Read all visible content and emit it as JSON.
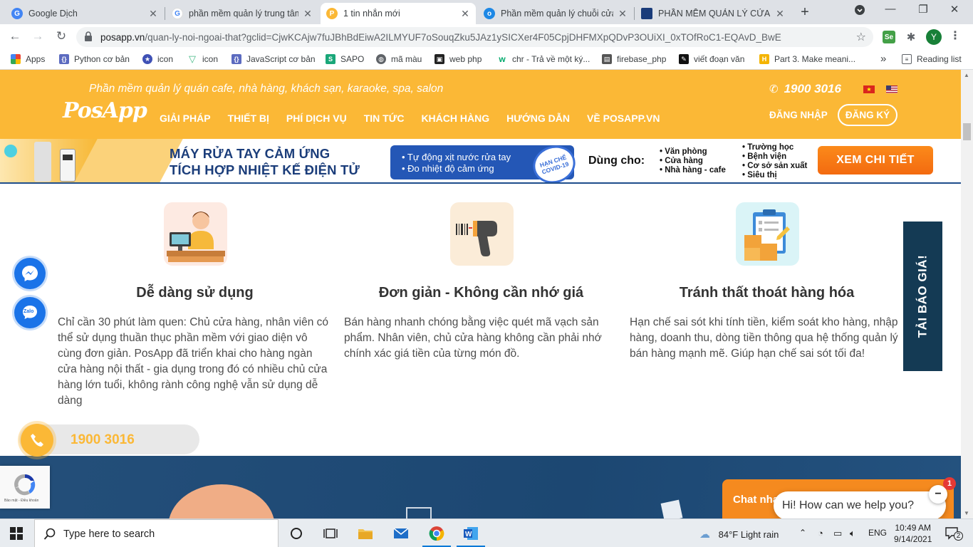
{
  "browser": {
    "tabs": [
      {
        "title": "Google Dịch",
        "favicon_color": "#4285f4",
        "favicon_glyph": "G",
        "active": false
      },
      {
        "title": "phần mềm quản lý trung tâm",
        "favicon_color": "#ffffff",
        "favicon_glyph": "G",
        "active": false
      },
      {
        "title": "1 tin nhắn mới",
        "favicon_color": "#fbb836",
        "favicon_glyph": "P",
        "active": true
      },
      {
        "title": "Phần mềm quản lý chuỗi cửa",
        "favicon_color": "#1e88e5",
        "favicon_glyph": "o",
        "active": false
      },
      {
        "title": "PHẦN MỀM QUẢN LÝ CỬA HÀ",
        "favicon_color": "#1a3c7a",
        "favicon_glyph": "",
        "active": false
      }
    ],
    "new_tab": "+",
    "url_host": "posapp.vn",
    "url_path": "/quan-ly-noi-ngoai-that?gclid=CjwKCAjw7fuJBhBdEiwA2ILMYUF7oSouqZku5JAz1ySICXer4F05CpjDHFMXpQDvP3OUiXI_0xTOfRoC1-EQAvD_BwE",
    "profile_initial": "Y",
    "bookmarks": [
      {
        "label": "Apps",
        "icon": "apps-grid-icon",
        "color": "#e94235"
      },
      {
        "label": "Python cơ bản",
        "icon": "bracket-icon",
        "color": "#5c6bc0"
      },
      {
        "label": "icon",
        "icon": "star-badge-icon",
        "color": "#3f51b5"
      },
      {
        "label": "icon",
        "icon": "vue-icon",
        "color": "#41b883"
      },
      {
        "label": "JavaScript cơ bản",
        "icon": "bracket-icon",
        "color": "#5c6bc0"
      },
      {
        "label": "SAPO",
        "icon": "sapo-icon",
        "color": "#1aa779"
      },
      {
        "label": "mã màu",
        "icon": "globe-icon",
        "color": "#5f6368"
      },
      {
        "label": "web php",
        "icon": "php-icon",
        "color": "#222222"
      },
      {
        "label": "chr - Trả về một ký...",
        "icon": "w3-icon",
        "color": "#04aa6d"
      },
      {
        "label": "firebase_php",
        "icon": "page-icon",
        "color": "#555555"
      },
      {
        "label": "viết đoạn văn",
        "icon": "pen-icon",
        "color": "#111111"
      },
      {
        "label": "Part 3. Make meani...",
        "icon": "h-icon",
        "color": "#f4b400"
      }
    ],
    "reading_list": "Reading list",
    "more_bookmarks": "»"
  },
  "site": {
    "tagline": "Phần mềm quản lý quán cafe, nhà hàng, khách sạn, karaoke, spa, salon",
    "logo": "PosApp",
    "nav": [
      "GIẢI PHÁP",
      "THIẾT BỊ",
      "PHÍ DỊCH VỤ",
      "TIN TỨC",
      "KHÁCH HÀNG",
      "HƯỚNG DẪN",
      "VỀ POSAPP.VN"
    ],
    "hotline": "1900 3016",
    "login": "ĐĂNG NHẬP",
    "register": "ĐĂNG KÝ",
    "accent": "#fbb836"
  },
  "banner": {
    "title_line1": "MÁY RỬA TAY CẢM ỨNG",
    "title_line2": "TÍCH HỢP NHIỆT KẾ ĐIỆN TỬ",
    "feature1": "• Tự động xịt nước rửa tay",
    "feature2": "• Đo nhiệt độ cảm ứng",
    "badge_line1": "HẠN CHẾ",
    "badge_line2": "COVID-19",
    "use_for": "Dùng cho:",
    "use_col1": [
      "• Văn phòng",
      "• Cửa hàng",
      "• Nhà hàng - cafe"
    ],
    "use_col2": [
      "• Trường học",
      "• Bệnh viện",
      "• Cơ sở sản xuất",
      "• Siêu thị"
    ],
    "cta": "XEM CHI TIẾT"
  },
  "features": [
    {
      "icon": "cashier-person-icon",
      "title": "Dễ dàng sử dụng",
      "desc": "Chỉ cần 30 phút làm quen: Chủ cửa hàng, nhân viên có thể sử dụng thuần thục phần mềm với giao diện vô cùng đơn giản. PosApp đã triển khai cho hàng ngàn cửa hàng nội thất - gia dụng trong đó có nhiều chủ cửa hàng lớn tuổi, không rành công nghệ vẫn sử dụng dễ dàng"
    },
    {
      "icon": "barcode-scanner-icon",
      "title": "Đơn giản - Không cần nhớ giá",
      "desc": "Bán hàng nhanh chóng bằng việc quét mã vạch sản phẩm. Nhân viên, chủ cửa hàng không cần phải nhớ chính xác giá tiền của từng món đồ."
    },
    {
      "icon": "inventory-clipboard-icon",
      "title": "Tránh thất thoát hàng hóa",
      "desc": "Hạn chế sai sót khi tính tiền, kiểm soát kho hàng, nhập hàng, doanh thu, dòng tiền thông qua hệ thống quản lý bán hàng mạnh mẽ. Giúp hạn chế sai sót tối đa!"
    }
  ],
  "floating": {
    "quote_tab": "TẢI BÁO GIÁ!",
    "phone_number": "1900 3016",
    "zalo": "Zalo",
    "recaptcha_text": "Bảo mật - Điều khoản",
    "chat_header": "Chat nhanh",
    "chat_prompt": "Hi! How can we help you?",
    "chat_badge": "1",
    "chat_min": "−"
  },
  "taskbar": {
    "search_placeholder": "Type here to search",
    "weather": "84°F  Light rain",
    "lang": "ENG",
    "time": "10:49 AM",
    "date": "9/14/2021",
    "notif_count": "2"
  }
}
